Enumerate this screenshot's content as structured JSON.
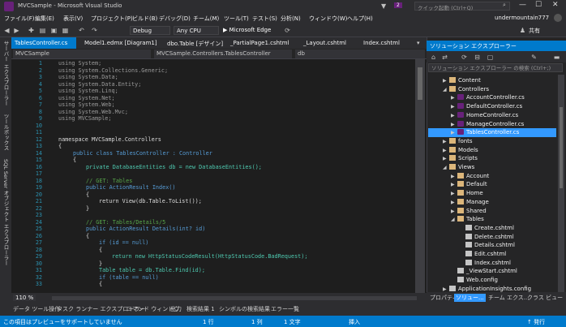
{
  "window": {
    "title": "MVCSample - Microsoft Visual Studio",
    "notification_count": "2",
    "quick_launch_placeholder": "クイック起動 (Ctrl+Q)",
    "user": "undermountain777"
  },
  "menu": [
    "ファイル(F)",
    "編集(E)",
    "表示(V)",
    "プロジェクト(P)",
    "ビルド(B)",
    "デバッグ(D)",
    "チーム(M)",
    "ツール(T)",
    "テスト(S)",
    "分析(N)",
    "ウィンドウ(W)",
    "ヘルプ(H)"
  ],
  "toolbar": {
    "config": "Debug",
    "platform": "Any CPU",
    "run_target": "▶ Microsoft Edge",
    "share_label": "共有"
  },
  "left_tabs": [
    "サーバー エクスプローラー",
    "ツールボックス",
    "SQL Server オブジェクト エクスプローラー"
  ],
  "tabs": [
    "TablesController.cs",
    "Model1.edmx [Diagram1]",
    "dbo.Table [デザイン]",
    "_PartialPage1.cshtml",
    "_Layout.cshtml",
    "Index.cshtml"
  ],
  "nav": {
    "project": "MVCSample",
    "class": "MVCSample.Controllers.TablesController",
    "member": "db"
  },
  "code": {
    "line_numbers": [
      "1",
      "2",
      "3",
      "4",
      "5",
      "6",
      "7",
      "8",
      "9",
      "10",
      "11",
      "12",
      "13",
      "14",
      "15",
      "16",
      "17",
      "18",
      "19",
      "20",
      "21",
      "22",
      "23",
      "24",
      "25",
      "26",
      "27",
      "28",
      "29",
      "30",
      "31",
      "32",
      "33"
    ],
    "l1": "using System;",
    "l2": "using System.Collections.Generic;",
    "l3": "using System.Data;",
    "l4": "using System.Data.Entity;",
    "l5": "using System.Linq;",
    "l6": "using System.Net;",
    "l7": "using System.Web;",
    "l8": "using System.Web.Mvc;",
    "l9": "using MVCSample;",
    "l11": "namespace MVCSample.Controllers",
    "l12": "{",
    "l13": "public class TablesController : Controller",
    "l14": "{",
    "l15": "private DatabaseEntities db = new DatabaseEntities();",
    "l17": "// GET: Tables",
    "l18": "public ActionResult Index()",
    "l19": "{",
    "l20": "return View(db.Table.ToList());",
    "l21": "}",
    "l23": "// GET: Tables/Details/5",
    "l24": "public ActionResult Details(int? id)",
    "l25": "{",
    "l26": "if (id == null)",
    "l27": "{",
    "l28": "return new HttpStatusCodeResult(HttpStatusCode.BadRequest);",
    "l29": "}",
    "l30": "Table table = db.Table.Find(id);",
    "l31": "if (table == null)",
    "l32": "{"
  },
  "zoom": "110 %",
  "solution_explorer": {
    "title": "ソリューション エクスプローラー",
    "search_placeholder": "ソリューション エクスプローラー の検索 (Ctrl+;)",
    "items": [
      {
        "label": "Content",
        "kind": "folder",
        "arrow": "▶",
        "indent": 1
      },
      {
        "label": "Controllers",
        "kind": "folder",
        "arrow": "◢",
        "indent": 1
      },
      {
        "label": "AccountController.cs",
        "kind": "cs",
        "arrow": "▶",
        "indent": 2
      },
      {
        "label": "DefaultController.cs",
        "kind": "cs",
        "arrow": "▶",
        "indent": 2
      },
      {
        "label": "HomeController.cs",
        "kind": "cs",
        "arrow": "▶",
        "indent": 2
      },
      {
        "label": "ManageController.cs",
        "kind": "cs",
        "arrow": "▶",
        "indent": 2
      },
      {
        "label": "TablesController.cs",
        "kind": "cs",
        "arrow": "▶",
        "indent": 2,
        "selected": true
      },
      {
        "label": "fonts",
        "kind": "folder",
        "arrow": "▶",
        "indent": 1
      },
      {
        "label": "Models",
        "kind": "folder",
        "arrow": "▶",
        "indent": 1
      },
      {
        "label": "Scripts",
        "kind": "folder",
        "arrow": "▶",
        "indent": 1
      },
      {
        "label": "Views",
        "kind": "folder",
        "arrow": "◢",
        "indent": 1
      },
      {
        "label": "Account",
        "kind": "folder",
        "arrow": "▶",
        "indent": 2
      },
      {
        "label": "Default",
        "kind": "folder",
        "arrow": "▶",
        "indent": 2
      },
      {
        "label": "Home",
        "kind": "folder",
        "arrow": "▶",
        "indent": 2
      },
      {
        "label": "Manage",
        "kind": "folder",
        "arrow": "▶",
        "indent": 2
      },
      {
        "label": "Shared",
        "kind": "folder",
        "arrow": "▶",
        "indent": 2
      },
      {
        "label": "Tables",
        "kind": "folder",
        "arrow": "◢",
        "indent": 2
      },
      {
        "label": "Create.cshtml",
        "kind": "file",
        "arrow": "",
        "indent": 3
      },
      {
        "label": "Delete.cshtml",
        "kind": "file",
        "arrow": "",
        "indent": 3
      },
      {
        "label": "Details.cshtml",
        "kind": "file",
        "arrow": "",
        "indent": 3
      },
      {
        "label": "Edit.cshtml",
        "kind": "file",
        "arrow": "",
        "indent": 3
      },
      {
        "label": "Index.cshtml",
        "kind": "file",
        "arrow": "",
        "indent": 3
      },
      {
        "label": "_ViewStart.cshtml",
        "kind": "file",
        "arrow": "",
        "indent": 2
      },
      {
        "label": "Web.config",
        "kind": "file",
        "arrow": "",
        "indent": 2
      },
      {
        "label": "ApplicationInsights.config",
        "kind": "file",
        "arrow": "▶",
        "indent": 1
      }
    ],
    "bottom_tabs": [
      "プロパティ",
      "ソリュー...",
      "チーム エクス...",
      "クラス ビュー"
    ]
  },
  "bottom_tabs": [
    "データ ツール操作",
    "タスク ランナー エクスプローラー",
    "コマンド ウィンドウ",
    "出力",
    "検索結果 1",
    "シンボルの検索結果",
    "エラー一覧"
  ],
  "status": {
    "message": "この項目はプレビューをサポートしていません",
    "line": "1 行",
    "col": "1 列",
    "char": "1 文字",
    "mode": "挿入",
    "publish": "↑ 発行"
  }
}
